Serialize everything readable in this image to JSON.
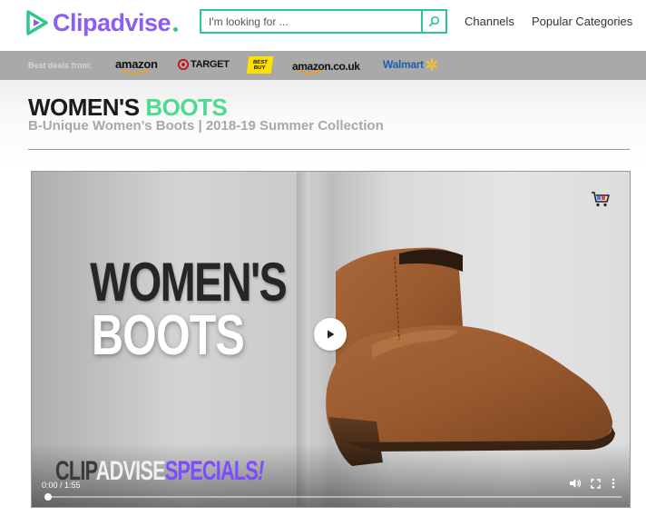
{
  "header": {
    "logo_text": "Clipadvise",
    "search_placeholder": "I'm looking for ...",
    "nav": [
      "Channels",
      "Popular Categories"
    ]
  },
  "deals": {
    "label": "Best deals from:",
    "stores": [
      {
        "name": "amazon",
        "key": "amazon"
      },
      {
        "name": "TARGET",
        "key": "target"
      },
      {
        "name": "BEST BUY",
        "key": "bestbuy"
      },
      {
        "name": "amazon.co.uk",
        "key": "amazon-uk"
      },
      {
        "name": "Walmart",
        "key": "walmart"
      }
    ]
  },
  "page": {
    "title_part1": "WOMEN'S",
    "title_part2": "BOOTS",
    "subtitle": "B-Unique Women's Boots | 2018-19 Summer Collection"
  },
  "video": {
    "overlay_line1": "WOMEN'S",
    "overlay_line2": "BOOTS",
    "brand_part1": "CLIP",
    "brand_part2": "ADVISE",
    "brand_part3": "SPECIALS",
    "brand_part4": "!",
    "time": "0:00 / 1:55",
    "progress": 0.0,
    "icons": [
      "play-icon",
      "cart-icon",
      "volume-icon",
      "fullscreen-icon",
      "more-options-icon"
    ]
  },
  "colors": {
    "brand_purple": "#8b5cf6",
    "accent_green": "#2ec98a",
    "title_green": "#4ddb8f",
    "deals_bar": "#a9a9a9"
  }
}
